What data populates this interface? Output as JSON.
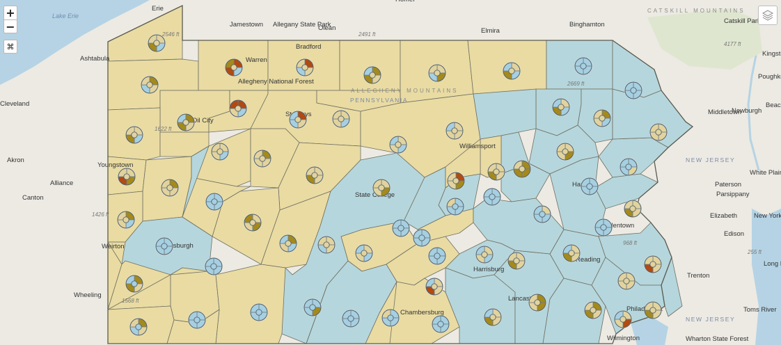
{
  "controls": {
    "zoom_in": "+",
    "zoom_out": "−",
    "fullscreen": "⌘"
  },
  "colors": {
    "water": "#b5d3e4",
    "land": "#eceae3",
    "hills": "#dfe6cf",
    "region_a": "#e9dba2",
    "region_b": "#b5d6dc",
    "county_border": "#6f6f62",
    "slice_light": "#e2d39e",
    "slice_blue": "#a6d0e1",
    "slice_olive": "#a48a1c",
    "slice_red": "#b24a12"
  },
  "labels": {
    "water": [
      "Lake Erie"
    ],
    "cities": [
      "Erie",
      "Jamestown",
      "Olean",
      "Elmira",
      "Binghamton",
      "Ashtabula",
      "Warren",
      "Bradford",
      "St Marys",
      "Oil City",
      "Williamsport",
      "Middletown",
      "Newburgh",
      "Kingston",
      "Poughkeepsie",
      "Beacon",
      "Akron",
      "Alliance",
      "Canton",
      "Youngstown",
      "Pittsburgh",
      "Weirton",
      "Wheeling",
      "State College",
      "Harrisburg",
      "Lancaster",
      "Reading",
      "Allentown",
      "Hazleton",
      "Philadelphia",
      "Chambersburg",
      "Wilmington",
      "Trenton",
      "Edison",
      "Elizabeth",
      "New York",
      "Paterson",
      "Parsippany",
      "White Plains",
      "Toms River",
      "Long Beach",
      "Wharton State Forest",
      "Allegany State Park",
      "Allegheny National Forest",
      "Catskill Park",
      "Cleveland",
      "Homer"
    ],
    "states": [
      "PENNSYLVANIA",
      "NEW JERSEY",
      "NEW JERSEY"
    ],
    "ranges": [
      "ALLEGHENY MOUNTAINS",
      "CATSKILL MOUNTAINS"
    ],
    "elevations": [
      "2491 ft",
      "2546 ft",
      "1622 ft",
      "1426 ft",
      "1568 ft",
      "2669 ft",
      "968 ft",
      "4177 ft",
      "255 ft"
    ]
  },
  "counties": [
    {
      "t": "a",
      "d": [
        0.2,
        0.3,
        0.25,
        0.25
      ]
    },
    {
      "t": "a",
      "d": [
        0.22,
        0.28,
        0.25,
        0.25
      ]
    },
    {
      "t": "a",
      "d": [
        0.25,
        0.25,
        0.25,
        0.25
      ]
    },
    {
      "t": "a",
      "d": [
        0.25,
        0.25,
        0.25,
        0.25
      ]
    },
    {
      "t": "a",
      "d": [
        0.25,
        0.25,
        0.25,
        0.25
      ]
    },
    {
      "t": "a",
      "d": [
        0.25,
        0.25,
        0.25,
        0.25
      ]
    },
    {
      "t": "a",
      "d": [
        0.25,
        0.25,
        0.25,
        0.25
      ]
    },
    {
      "t": "a",
      "d": [
        0.35,
        0.25,
        0.25,
        0.15
      ]
    },
    {
      "t": "a",
      "d": [
        0.25,
        0.25,
        0.25,
        0.25
      ]
    },
    {
      "t": "a",
      "d": [
        0.25,
        0.25,
        0.25,
        0.25
      ]
    },
    {
      "t": "a",
      "d": [
        0.2,
        0.25,
        0.3,
        0.25
      ]
    },
    {
      "t": "a",
      "d": [
        0.25,
        0.25,
        0.25,
        0.25
      ]
    },
    {
      "t": "a",
      "d": [
        0.25,
        0.25,
        0.25,
        0.25
      ]
    },
    {
      "t": "a",
      "d": [
        0.25,
        0.25,
        0.25,
        0.25
      ]
    },
    {
      "t": "a",
      "d": [
        0.3,
        0.3,
        0.2,
        0.2
      ]
    },
    {
      "t": "a",
      "d": [
        0.25,
        0.25,
        0.25,
        0.25
      ]
    },
    {
      "t": "a",
      "d": [
        0.25,
        0.25,
        0.25,
        0.25
      ]
    },
    {
      "t": "a",
      "d": [
        0.25,
        0.25,
        0.25,
        0.25
      ]
    },
    {
      "t": "a",
      "d": [
        0.25,
        0.25,
        0.25,
        0.25
      ]
    },
    {
      "t": "a",
      "d": [
        0.25,
        0.25,
        0.25,
        0.25
      ]
    },
    {
      "t": "a",
      "d": [
        0.25,
        0.25,
        0.25,
        0.25
      ]
    },
    {
      "t": "a",
      "d": [
        0.25,
        0.25,
        0.25,
        0.25
      ]
    },
    {
      "t": "a",
      "d": [
        0.25,
        0.25,
        0.25,
        0.25
      ]
    },
    {
      "t": "a",
      "d": [
        0.25,
        0.25,
        0.25,
        0.25
      ]
    },
    {
      "t": "a",
      "d": [
        0.25,
        0.25,
        0.25,
        0.25
      ]
    },
    {
      "t": "a",
      "d": [
        0.25,
        0.25,
        0.25,
        0.25
      ]
    },
    {
      "t": "a",
      "d": [
        0.25,
        0.25,
        0.25,
        0.25
      ]
    },
    {
      "t": "a",
      "d": [
        0.25,
        0.25,
        0.25,
        0.25
      ]
    },
    {
      "t": "a",
      "d": [
        0.25,
        0.25,
        0.25,
        0.25
      ]
    },
    {
      "t": "a",
      "d": [
        0.25,
        0.25,
        0.25,
        0.25
      ]
    },
    {
      "t": "a",
      "d": [
        0.25,
        0.25,
        0.25,
        0.25
      ]
    },
    {
      "t": "a",
      "d": [
        0.25,
        0.25,
        0.25,
        0.25
      ]
    },
    {
      "t": "a",
      "d": [
        0.25,
        0.25,
        0.25,
        0.25
      ]
    },
    {
      "t": "b",
      "d": [
        0.25,
        0.25,
        0.25,
        0.25
      ]
    },
    {
      "t": "b",
      "d": [
        0.25,
        0.25,
        0.25,
        0.25
      ]
    },
    {
      "t": "b",
      "d": [
        0.25,
        0.25,
        0.25,
        0.25
      ]
    },
    {
      "t": "b",
      "d": [
        0.25,
        0.25,
        0.25,
        0.25
      ]
    },
    {
      "t": "b",
      "d": [
        0.25,
        0.25,
        0.25,
        0.25
      ]
    },
    {
      "t": "b",
      "d": [
        0.25,
        0.25,
        0.25,
        0.25
      ]
    },
    {
      "t": "b",
      "d": [
        0.25,
        0.25,
        0.25,
        0.25
      ]
    },
    {
      "t": "b",
      "d": [
        0.25,
        0.25,
        0.25,
        0.25
      ]
    },
    {
      "t": "b",
      "d": [
        0.25,
        0.25,
        0.25,
        0.25
      ]
    },
    {
      "t": "b",
      "d": [
        0.25,
        0.25,
        0.25,
        0.25
      ]
    },
    {
      "t": "b",
      "d": [
        0.25,
        0.25,
        0.25,
        0.25
      ]
    },
    {
      "t": "b",
      "d": [
        0.25,
        0.25,
        0.25,
        0.25
      ]
    },
    {
      "t": "b",
      "d": [
        0.25,
        0.25,
        0.25,
        0.25
      ]
    },
    {
      "t": "b",
      "d": [
        0.25,
        0.25,
        0.25,
        0.25
      ]
    },
    {
      "t": "b",
      "d": [
        0.25,
        0.25,
        0.25,
        0.25
      ]
    },
    {
      "t": "b",
      "d": [
        0.25,
        0.25,
        0.25,
        0.25
      ]
    },
    {
      "t": "b",
      "d": [
        0.25,
        0.25,
        0.25,
        0.25
      ]
    },
    {
      "t": "b",
      "d": [
        0.25,
        0.25,
        0.25,
        0.25
      ]
    },
    {
      "t": "b",
      "d": [
        0.25,
        0.25,
        0.25,
        0.25
      ]
    },
    {
      "t": "b",
      "d": [
        0.25,
        0.25,
        0.25,
        0.25
      ]
    },
    {
      "t": "b",
      "d": [
        0.25,
        0.25,
        0.25,
        0.25
      ]
    },
    {
      "t": "b",
      "d": [
        0.25,
        0.25,
        0.25,
        0.25
      ]
    },
    {
      "t": "b",
      "d": [
        0.25,
        0.25,
        0.25,
        0.25
      ]
    },
    {
      "t": "b",
      "d": [
        0.25,
        0.25,
        0.25,
        0.25
      ]
    },
    {
      "t": "b",
      "d": [
        0.25,
        0.25,
        0.25,
        0.25
      ]
    },
    {
      "t": "b",
      "d": [
        0.25,
        0.25,
        0.25,
        0.25
      ]
    },
    {
      "t": "b",
      "d": [
        0.25,
        0.25,
        0.25,
        0.25
      ]
    },
    {
      "t": "a",
      "d": [
        0.25,
        0.25,
        0.25,
        0.25
      ]
    },
    {
      "t": "a",
      "d": [
        0.25,
        0.25,
        0.25,
        0.25
      ]
    },
    {
      "t": "a",
      "d": [
        0.25,
        0.25,
        0.25,
        0.25
      ]
    },
    {
      "t": "a",
      "d": [
        0.25,
        0.25,
        0.25,
        0.25
      ]
    },
    {
      "t": "a",
      "d": [
        0.25,
        0.25,
        0.25,
        0.25
      ]
    },
    {
      "t": "a",
      "d": [
        0.25,
        0.25,
        0.25,
        0.25
      ]
    },
    {
      "t": "b",
      "d": [
        0.25,
        0.25,
        0.25,
        0.25
      ]
    }
  ],
  "markers": [
    {
      "k": "a",
      "s": [
        "L",
        "B",
        "O",
        "L"
      ]
    },
    {
      "k": "a",
      "s": [
        "O",
        "L",
        "B",
        "L"
      ]
    },
    {
      "k": "a",
      "s": [
        "R",
        "B",
        "R",
        "O"
      ]
    },
    {
      "k": "a",
      "s": [
        "R",
        "L",
        "B",
        "L"
      ]
    },
    {
      "k": "a",
      "s": [
        "O",
        "L",
        "O",
        "B"
      ]
    },
    {
      "k": "a",
      "s": [
        "L",
        "O",
        "B",
        "L"
      ]
    },
    {
      "k": "a",
      "s": [
        "L",
        "B",
        "O",
        "B"
      ]
    },
    {
      "k": "b",
      "s": [
        "B",
        "B",
        "B",
        "B"
      ]
    },
    {
      "k": "b",
      "s": [
        "B",
        "B",
        "B",
        "B"
      ]
    },
    {
      "k": "a",
      "s": [
        "L",
        "B",
        "O",
        "L"
      ]
    },
    {
      "k": "a",
      "s": [
        "O",
        "L",
        "O",
        "B"
      ]
    },
    {
      "k": "a",
      "s": [
        "R",
        "B",
        "L",
        "R"
      ]
    },
    {
      "k": "a",
      "s": [
        "R",
        "L",
        "B",
        "B"
      ]
    },
    {
      "k": "a",
      "s": [
        "L",
        "B",
        "L",
        "L"
      ]
    },
    {
      "k": "a",
      "s": [
        "L",
        "B",
        "L",
        "B"
      ]
    },
    {
      "k": "a",
      "s": [
        "L",
        "L",
        "L",
        "B"
      ]
    },
    {
      "k": "a",
      "s": [
        "L",
        "B",
        "O",
        "B"
      ]
    },
    {
      "k": "a",
      "s": [
        "O",
        "B",
        "L",
        "L"
      ]
    },
    {
      "k": "a",
      "s": [
        "L",
        "L",
        "L",
        "L"
      ]
    },
    {
      "k": "a",
      "s": [
        "L",
        "O",
        "R",
        "L"
      ]
    },
    {
      "k": "a",
      "s": [
        "O",
        "L",
        "L",
        "L"
      ]
    },
    {
      "k": "a",
      "s": [
        "L",
        "B",
        "L",
        "L"
      ]
    },
    {
      "k": "a",
      "s": [
        "O",
        "L",
        "L",
        "L"
      ]
    },
    {
      "k": "a",
      "s": [
        "L",
        "L",
        "O",
        "L"
      ]
    },
    {
      "k": "a",
      "s": [
        "L",
        "O",
        "L",
        "L"
      ]
    },
    {
      "k": "a",
      "s": [
        "R",
        "O",
        "L",
        "L"
      ]
    },
    {
      "k": "a",
      "s": [
        "L",
        "L",
        "O",
        "L"
      ]
    },
    {
      "k": "a",
      "s": [
        "O",
        "O",
        "O",
        "L"
      ]
    },
    {
      "k": "a",
      "s": [
        "L",
        "O",
        "L",
        "L"
      ]
    },
    {
      "k": "b",
      "s": [
        "B",
        "L",
        "B",
        "B"
      ]
    },
    {
      "k": "b",
      "s": [
        "B",
        "B",
        "B",
        "B"
      ]
    },
    {
      "k": "b",
      "s": [
        "B",
        "B",
        "B",
        "B"
      ]
    },
    {
      "k": "b",
      "s": [
        "B",
        "B",
        "B",
        "L"
      ]
    },
    {
      "k": "b",
      "s": [
        "L",
        "B",
        "B",
        "B"
      ]
    },
    {
      "k": "b",
      "s": [
        "B",
        "B",
        "B",
        "B"
      ]
    },
    {
      "k": "b",
      "s": [
        "B",
        "B",
        "B",
        "B"
      ]
    },
    {
      "k": "a",
      "s": [
        "O",
        "B",
        "L",
        "L"
      ]
    },
    {
      "k": "a",
      "s": [
        "L",
        "O",
        "L",
        "O"
      ]
    },
    {
      "k": "a",
      "s": [
        "O",
        "B",
        "L",
        "B"
      ]
    },
    {
      "k": "a",
      "s": [
        "L",
        "L",
        "B",
        "L"
      ]
    },
    {
      "k": "a",
      "s": [
        "L",
        "B",
        "L",
        "B"
      ]
    },
    {
      "k": "b",
      "s": [
        "B",
        "B",
        "B",
        "B"
      ]
    },
    {
      "k": "b",
      "s": [
        "B",
        "B",
        "B",
        "B"
      ]
    },
    {
      "k": "b",
      "s": [
        "B",
        "B",
        "B",
        "B"
      ]
    },
    {
      "k": "a",
      "s": [
        "L",
        "B",
        "L",
        "B"
      ]
    },
    {
      "k": "a",
      "s": [
        "L",
        "L",
        "O",
        "L"
      ]
    },
    {
      "k": "a",
      "s": [
        "L",
        "L",
        "O",
        "B"
      ]
    },
    {
      "k": "b",
      "s": [
        "B",
        "B",
        "B",
        "B"
      ]
    },
    {
      "k": "a",
      "s": [
        "L",
        "L",
        "O",
        "L"
      ]
    },
    {
      "k": "a",
      "s": [
        "L",
        "L",
        "R",
        "L"
      ]
    },
    {
      "k": "a",
      "s": [
        "L",
        "L",
        "L",
        "L"
      ]
    },
    {
      "k": "a",
      "s": [
        "O",
        "L",
        "O",
        "L"
      ]
    },
    {
      "k": "a",
      "s": [
        "O",
        "O",
        "L",
        "L"
      ]
    },
    {
      "k": "a",
      "s": [
        "L",
        "L",
        "O",
        "B"
      ]
    },
    {
      "k": "b",
      "s": [
        "B",
        "B",
        "B",
        "B"
      ]
    },
    {
      "k": "b",
      "s": [
        "B",
        "B",
        "B",
        "L"
      ]
    },
    {
      "k": "b",
      "s": [
        "B",
        "B",
        "B",
        "B"
      ]
    },
    {
      "k": "b",
      "s": [
        "B",
        "O",
        "B",
        "B"
      ]
    },
    {
      "k": "b",
      "s": [
        "B",
        "B",
        "B",
        "B"
      ]
    },
    {
      "k": "b",
      "s": [
        "B",
        "B",
        "B",
        "B"
      ]
    },
    {
      "k": "b",
      "s": [
        "O",
        "L",
        "B",
        "L"
      ]
    },
    {
      "k": "b",
      "s": [
        "O",
        "L",
        "O",
        "B"
      ]
    },
    {
      "k": "b",
      "s": [
        "B",
        "B",
        "B",
        "B"
      ]
    },
    {
      "k": "a",
      "s": [
        "L",
        "L",
        "R",
        "B"
      ]
    },
    {
      "k": "a",
      "s": [
        "L",
        "R",
        "L",
        "B"
      ]
    },
    {
      "k": "a",
      "s": [
        "L",
        "L",
        "O",
        "L"
      ]
    },
    {
      "k": "b",
      "s": [
        "B",
        "B",
        "B",
        "B"
      ]
    },
    {
      "k": "b",
      "s": [
        "B",
        "B",
        "B",
        "B"
      ]
    },
    {
      "k": "b",
      "s": [
        "L",
        "L",
        "O",
        "O"
      ]
    },
    {
      "k": "b",
      "s": [
        "B",
        "L",
        "B",
        "O"
      ]
    },
    {
      "k": "b",
      "s": [
        "B",
        "B",
        "B",
        "B"
      ]
    },
    {
      "k": "b",
      "s": [
        "B",
        "B",
        "B",
        "B"
      ]
    },
    {
      "k": "a",
      "s": [
        "O",
        "L",
        "B",
        "L"
      ]
    }
  ]
}
